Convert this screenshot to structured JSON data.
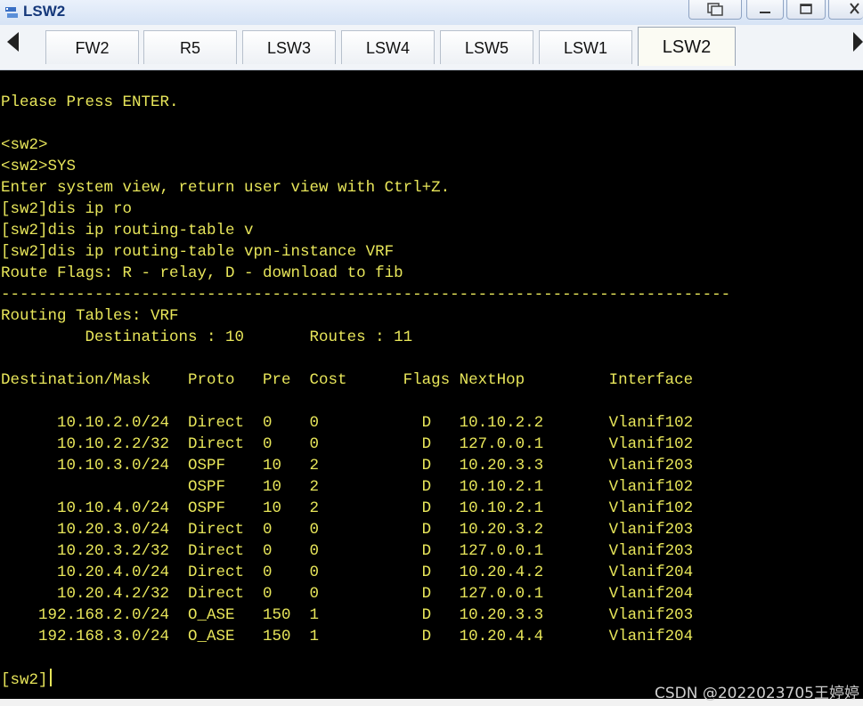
{
  "window": {
    "title": "LSW2",
    "icon": "device-icon"
  },
  "tabs": [
    {
      "label": "FW2",
      "active": false
    },
    {
      "label": "R5",
      "active": false
    },
    {
      "label": "LSW3",
      "active": false
    },
    {
      "label": "LSW4",
      "active": false
    },
    {
      "label": "LSW5",
      "active": false
    },
    {
      "label": "LSW1",
      "active": false
    },
    {
      "label": "LSW2",
      "active": true
    }
  ],
  "terminal": {
    "text_color": "#e8e65a",
    "background": "#000000",
    "lines": [
      "Please Press ENTER.",
      "",
      "<sw2>",
      "<sw2>SYS",
      "Enter system view, return user view with Ctrl+Z.",
      "[sw2]dis ip ro",
      "[sw2]dis ip routing-table v",
      "[sw2]dis ip routing-table vpn-instance VRF",
      "Route Flags: R - relay, D - download to fib",
      "------------------------------------------------------------------------------",
      "Routing Tables: VRF",
      "         Destinations : 10       Routes : 11",
      "",
      "Destination/Mask    Proto   Pre  Cost      Flags NextHop         Interface",
      "",
      "      10.10.2.0/24  Direct  0    0           D   10.10.2.2       Vlanif102",
      "      10.10.2.2/32  Direct  0    0           D   127.0.0.1       Vlanif102",
      "      10.10.3.0/24  OSPF    10   2           D   10.20.3.3       Vlanif203",
      "                    OSPF    10   2           D   10.10.2.1       Vlanif102",
      "      10.10.4.0/24  OSPF    10   2           D   10.10.2.1       Vlanif102",
      "      10.20.3.0/24  Direct  0    0           D   10.20.3.2       Vlanif203",
      "      10.20.3.2/32  Direct  0    0           D   127.0.0.1       Vlanif203",
      "      10.20.4.0/24  Direct  0    0           D   10.20.4.2       Vlanif204",
      "      10.20.4.2/32  Direct  0    0           D   127.0.0.1       Vlanif204",
      "    192.168.2.0/24  O_ASE   150  1           D   10.20.3.3       Vlanif203",
      "    192.168.3.0/24  O_ASE   150  1           D   10.20.4.4       Vlanif204",
      "",
      "[sw2]"
    ]
  },
  "watermark": "CSDN @2022023705王婷婷"
}
